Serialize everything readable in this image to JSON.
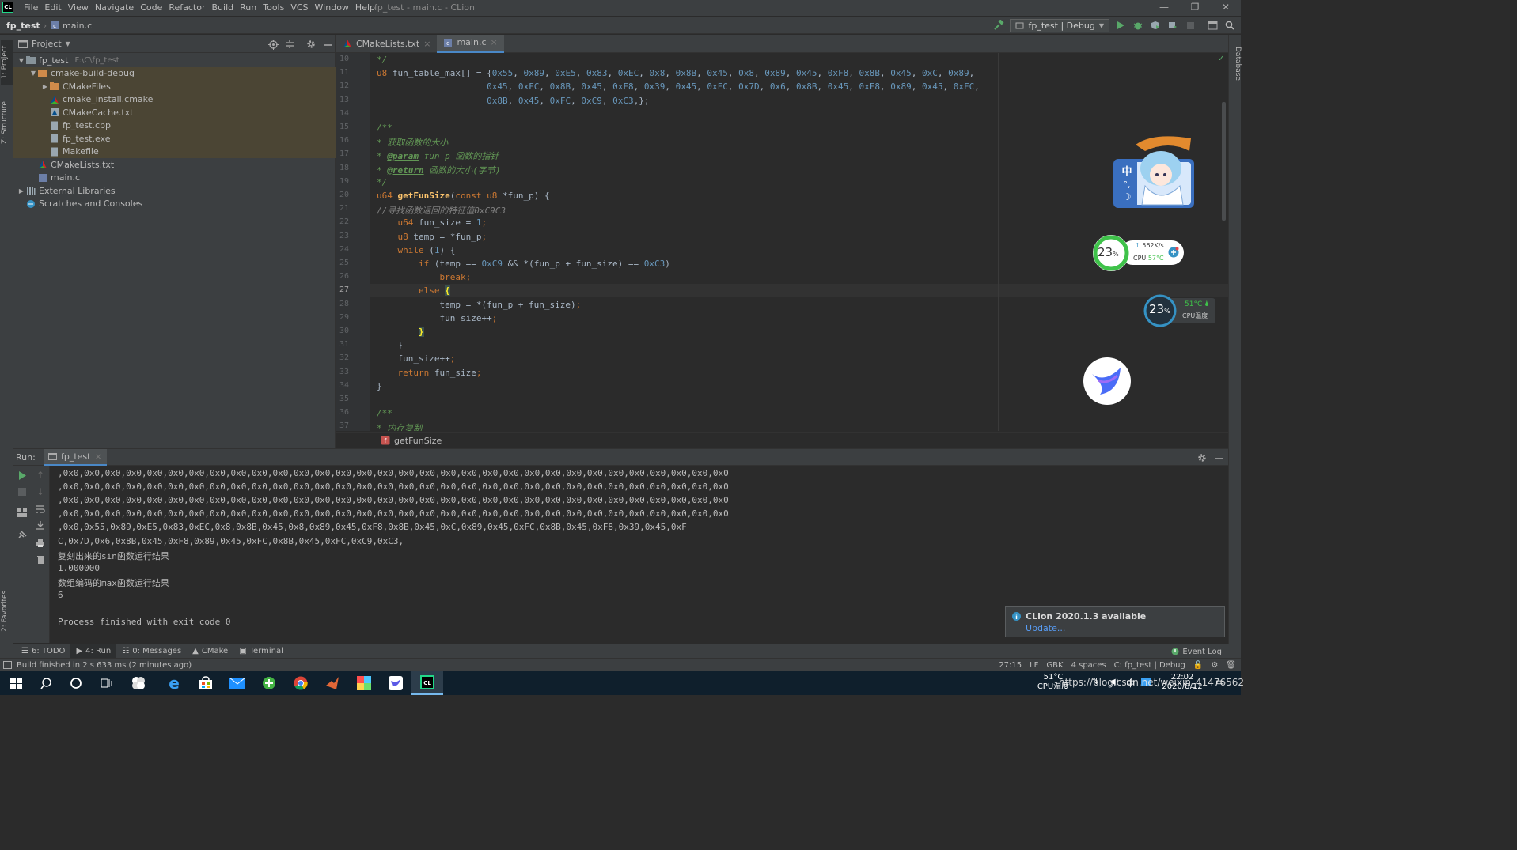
{
  "window": {
    "app_badge": "CL",
    "menu": [
      "File",
      "Edit",
      "View",
      "Navigate",
      "Code",
      "Refactor",
      "Build",
      "Run",
      "Tools",
      "VCS",
      "Window",
      "Help"
    ],
    "title": "fp_test - main.c - CLion"
  },
  "navbar": {
    "project": "fp_test",
    "file": "main.c",
    "run_config": "fp_test | Debug"
  },
  "left_strip": {
    "project_tab": "1: Project",
    "structure_tab": "Z: Structure",
    "favorites_tab": "2: Favorites"
  },
  "right_strip": {
    "database_tab": "Database"
  },
  "project_panel": {
    "title": "Project",
    "items": [
      {
        "label": "fp_test",
        "hint": "F:\\C\\fp_test",
        "depth": 0,
        "arrow": "▼",
        "icon": "folder",
        "sel": false
      },
      {
        "label": "cmake-build-debug",
        "depth": 1,
        "arrow": "▼",
        "icon": "folder-orange",
        "sel": true
      },
      {
        "label": "CMakeFiles",
        "depth": 2,
        "arrow": "▶",
        "icon": "folder-orange",
        "sel": true
      },
      {
        "label": "cmake_install.cmake",
        "depth": 2,
        "arrow": "",
        "icon": "cmake",
        "sel": true
      },
      {
        "label": "CMakeCache.txt",
        "depth": 2,
        "arrow": "",
        "icon": "cmakecache",
        "sel": true
      },
      {
        "label": "fp_test.cbp",
        "depth": 2,
        "arrow": "",
        "icon": "file",
        "sel": true
      },
      {
        "label": "fp_test.exe",
        "depth": 2,
        "arrow": "",
        "icon": "file",
        "sel": true
      },
      {
        "label": "Makefile",
        "depth": 2,
        "arrow": "",
        "icon": "file",
        "sel": true
      },
      {
        "label": "CMakeLists.txt",
        "depth": 1,
        "arrow": "",
        "icon": "cmake",
        "sel": false
      },
      {
        "label": "main.c",
        "depth": 1,
        "arrow": "",
        "icon": "cfile",
        "sel": false
      },
      {
        "label": "External Libraries",
        "depth": 0,
        "arrow": "▶",
        "icon": "library",
        "sel": false
      },
      {
        "label": "Scratches and Consoles",
        "depth": 0,
        "arrow": "",
        "icon": "scratch",
        "sel": false
      }
    ]
  },
  "editor": {
    "tabs": [
      {
        "label": "CMakeLists.txt",
        "active": false
      },
      {
        "label": "main.c",
        "active": true
      }
    ],
    "line_numbers": [
      "10",
      "11",
      "12",
      "13",
      "14",
      "15",
      "16",
      "17",
      "18",
      "19",
      "20",
      "21",
      "22",
      "23",
      "24",
      "25",
      "26",
      "27",
      "28",
      "29",
      "30",
      "31",
      "32",
      "33",
      "34",
      "35",
      "36",
      "37"
    ],
    "current_line": "27",
    "lines": [
      [
        [
          "*/",
          "cm"
        ]
      ],
      [
        [
          "u8 ",
          "kw"
        ],
        [
          "fun_table_max[] = {",
          ""
        ],
        [
          "0x55",
          "nu"
        ],
        [
          ", ",
          ""
        ],
        [
          "0x89",
          "nu"
        ],
        [
          ", ",
          ""
        ],
        [
          "0xE5",
          "nu"
        ],
        [
          ", ",
          ""
        ],
        [
          "0x83",
          "nu"
        ],
        [
          ", ",
          ""
        ],
        [
          "0xEC",
          "nu"
        ],
        [
          ", ",
          ""
        ],
        [
          "0x8",
          "nu"
        ],
        [
          ", ",
          ""
        ],
        [
          "0x8B",
          "nu"
        ],
        [
          ", ",
          ""
        ],
        [
          "0x45",
          "nu"
        ],
        [
          ", ",
          ""
        ],
        [
          "0x8",
          "nu"
        ],
        [
          ", ",
          ""
        ],
        [
          "0x89",
          "nu"
        ],
        [
          ", ",
          ""
        ],
        [
          "0x45",
          "nu"
        ],
        [
          ", ",
          ""
        ],
        [
          "0xF8",
          "nu"
        ],
        [
          ", ",
          ""
        ],
        [
          "0x8B",
          "nu"
        ],
        [
          ", ",
          ""
        ],
        [
          "0x45",
          "nu"
        ],
        [
          ", ",
          ""
        ],
        [
          "0xC",
          "nu"
        ],
        [
          ", ",
          ""
        ],
        [
          "0x89",
          "nu"
        ],
        [
          ",",
          ""
        ]
      ],
      [
        [
          "                     ",
          ""
        ],
        [
          "0x45",
          "nu"
        ],
        [
          ", ",
          ""
        ],
        [
          "0xFC",
          "nu"
        ],
        [
          ", ",
          ""
        ],
        [
          "0x8B",
          "nu"
        ],
        [
          ", ",
          ""
        ],
        [
          "0x45",
          "nu"
        ],
        [
          ", ",
          ""
        ],
        [
          "0xF8",
          "nu"
        ],
        [
          ", ",
          ""
        ],
        [
          "0x39",
          "nu"
        ],
        [
          ", ",
          ""
        ],
        [
          "0x45",
          "nu"
        ],
        [
          ", ",
          ""
        ],
        [
          "0xFC",
          "nu"
        ],
        [
          ", ",
          ""
        ],
        [
          "0x7D",
          "nu"
        ],
        [
          ", ",
          ""
        ],
        [
          "0x6",
          "nu"
        ],
        [
          ", ",
          ""
        ],
        [
          "0x8B",
          "nu"
        ],
        [
          ", ",
          ""
        ],
        [
          "0x45",
          "nu"
        ],
        [
          ", ",
          ""
        ],
        [
          "0xF8",
          "nu"
        ],
        [
          ", ",
          ""
        ],
        [
          "0x89",
          "nu"
        ],
        [
          ", ",
          ""
        ],
        [
          "0x45",
          "nu"
        ],
        [
          ", ",
          ""
        ],
        [
          "0xFC",
          "nu"
        ],
        [
          ",",
          ""
        ]
      ],
      [
        [
          "                     ",
          ""
        ],
        [
          "0x8B",
          "nu"
        ],
        [
          ", ",
          ""
        ],
        [
          "0x45",
          "nu"
        ],
        [
          ", ",
          ""
        ],
        [
          "0xFC",
          "nu"
        ],
        [
          ", ",
          ""
        ],
        [
          "0xC9",
          "nu"
        ],
        [
          ", ",
          ""
        ],
        [
          "0xC3",
          "nu"
        ],
        [
          ",};",
          ""
        ]
      ],
      [],
      [
        [
          "/**",
          "cm"
        ]
      ],
      [
        [
          "* 获取函数的大小",
          "cm"
        ]
      ],
      [
        [
          "* ",
          "cm"
        ],
        [
          "@param",
          "tag"
        ],
        [
          " fun_p ",
          "cmi"
        ],
        [
          "函数的指针",
          "cm"
        ]
      ],
      [
        [
          "* ",
          "cm"
        ],
        [
          "@return",
          "tag"
        ],
        [
          " 函数的大小(字节)",
          "cm"
        ]
      ],
      [
        [
          "*/",
          "cm"
        ]
      ],
      [
        [
          "u64 ",
          "kw"
        ],
        [
          "getFunSize",
          "fn"
        ],
        [
          "(",
          ""
        ],
        [
          "const ",
          "kw"
        ],
        [
          "u8 ",
          "kw"
        ],
        [
          "*fun_p) {",
          ""
        ]
      ],
      [
        [
          "//寻找函数返回的特征值0xC9C3",
          "lc"
        ]
      ],
      [
        [
          "    u64 ",
          "kw"
        ],
        [
          "fun_size = ",
          ""
        ],
        [
          "1",
          "nu"
        ],
        [
          ";",
          "kw"
        ]
      ],
      [
        [
          "    u8 ",
          "kw"
        ],
        [
          "temp = *fun_p",
          ""
        ],
        [
          ";",
          "kw"
        ]
      ],
      [
        [
          "    while ",
          "kw"
        ],
        [
          "(",
          ""
        ],
        [
          "1",
          "nu"
        ],
        [
          ") {",
          ""
        ]
      ],
      [
        [
          "        if ",
          "kw"
        ],
        [
          "(temp == ",
          ""
        ],
        [
          "0xC9",
          "nu"
        ],
        [
          " && *(fun_p + fun_size) == ",
          ""
        ],
        [
          "0xC3",
          "nu"
        ],
        [
          ")",
          ""
        ]
      ],
      [
        [
          "            break",
          "kw"
        ],
        [
          ";",
          "kw"
        ]
      ],
      [
        [
          "        else ",
          "kw"
        ],
        [
          "{",
          "br"
        ]
      ],
      [
        [
          "            temp = *(fun_p + fun_size)",
          ""
        ],
        [
          ";",
          "kw"
        ]
      ],
      [
        [
          "            fun_size++",
          ""
        ],
        [
          ";",
          "kw"
        ]
      ],
      [
        [
          "        ",
          ""
        ],
        [
          "}",
          "br"
        ]
      ],
      [
        [
          "    }",
          ""
        ]
      ],
      [
        [
          "    fun_size++",
          ""
        ],
        [
          ";",
          "kw"
        ]
      ],
      [
        [
          "    return ",
          "kw"
        ],
        [
          "fun_size",
          ""
        ],
        [
          ";",
          "kw"
        ]
      ],
      [
        [
          "}",
          ""
        ]
      ],
      [],
      [
        [
          "/**",
          "cm"
        ]
      ],
      [
        [
          "* 内存复制",
          "cm"
        ]
      ]
    ],
    "breadcrumb": "getFunSize"
  },
  "run_panel": {
    "label": "Run:",
    "tab": "fp_test",
    "output": [
      ",0x0,0x0,0x0,0x0,0x0,0x0,0x0,0x0,0x0,0x0,0x0,0x0,0x0,0x0,0x0,0x0,0x0,0x0,0x0,0x0,0x0,0x0,0x0,0x0,0x0,0x0,0x0,0x0,0x0,0x0,0x0,0x0",
      ",0x0,0x0,0x0,0x0,0x0,0x0,0x0,0x0,0x0,0x0,0x0,0x0,0x0,0x0,0x0,0x0,0x0,0x0,0x0,0x0,0x0,0x0,0x0,0x0,0x0,0x0,0x0,0x0,0x0,0x0,0x0,0x0",
      ",0x0,0x0,0x0,0x0,0x0,0x0,0x0,0x0,0x0,0x0,0x0,0x0,0x0,0x0,0x0,0x0,0x0,0x0,0x0,0x0,0x0,0x0,0x0,0x0,0x0,0x0,0x0,0x0,0x0,0x0,0x0,0x0",
      ",0x0,0x0,0x0,0x0,0x0,0x0,0x0,0x0,0x0,0x0,0x0,0x0,0x0,0x0,0x0,0x0,0x0,0x0,0x0,0x0,0x0,0x0,0x0,0x0,0x0,0x0,0x0,0x0,0x0,0x0,0x0,0x0",
      ",0x0,0x55,0x89,0xE5,0x83,0xEC,0x8,0x8B,0x45,0x8,0x89,0x45,0xF8,0x8B,0x45,0xC,0x89,0x45,0xFC,0x8B,0x45,0xF8,0x39,0x45,0xF",
      "C,0x7D,0x6,0x8B,0x45,0xF8,0x89,0x45,0xFC,0x8B,0x45,0xFC,0xC9,0xC3,",
      "复刻出来的sin函数运行结果",
      "1.000000",
      "数组编码的max函数运行结果",
      "6",
      "",
      "Process finished with exit code 0"
    ]
  },
  "bottom_tabs": [
    "6: TODO",
    "4: Run",
    "0: Messages",
    "CMake",
    "Terminal"
  ],
  "event_log": "Event Log",
  "status": {
    "message": "Build finished in 2 s 633 ms (2 minutes ago)",
    "position": "27:15",
    "line_sep": "LF",
    "encoding": "GBK",
    "indent": "4 spaces",
    "context": "C: fp_test | Debug"
  },
  "notification": {
    "title": "CLion 2020.1.3 available",
    "link": "Update..."
  },
  "widgets": {
    "ime_char": "中",
    "net_speed": "562K/s",
    "cpu_label": "CPU",
    "cpu_temp": "57°C",
    "load_big": "23",
    "load_small": "23",
    "percent": "%",
    "temp2": "51°C",
    "temp2_label": "CPU温度"
  },
  "taskbar": {
    "tray_temp": "51°C",
    "tray_temp_label": "CPU温度",
    "tray_ime": "中",
    "time": "22:02",
    "date": "2020/8/12",
    "watermark": "https://blog.csdn.net/weixin_41476562"
  },
  "colors": {
    "editor_bg": "#2b2b2b",
    "panel_bg": "#3c3f41",
    "keyword": "#cc7832",
    "number": "#6897bb",
    "comment": "#629755",
    "line_comment": "#808080",
    "function": "#ffc66d",
    "accent": "#4a88c7"
  }
}
